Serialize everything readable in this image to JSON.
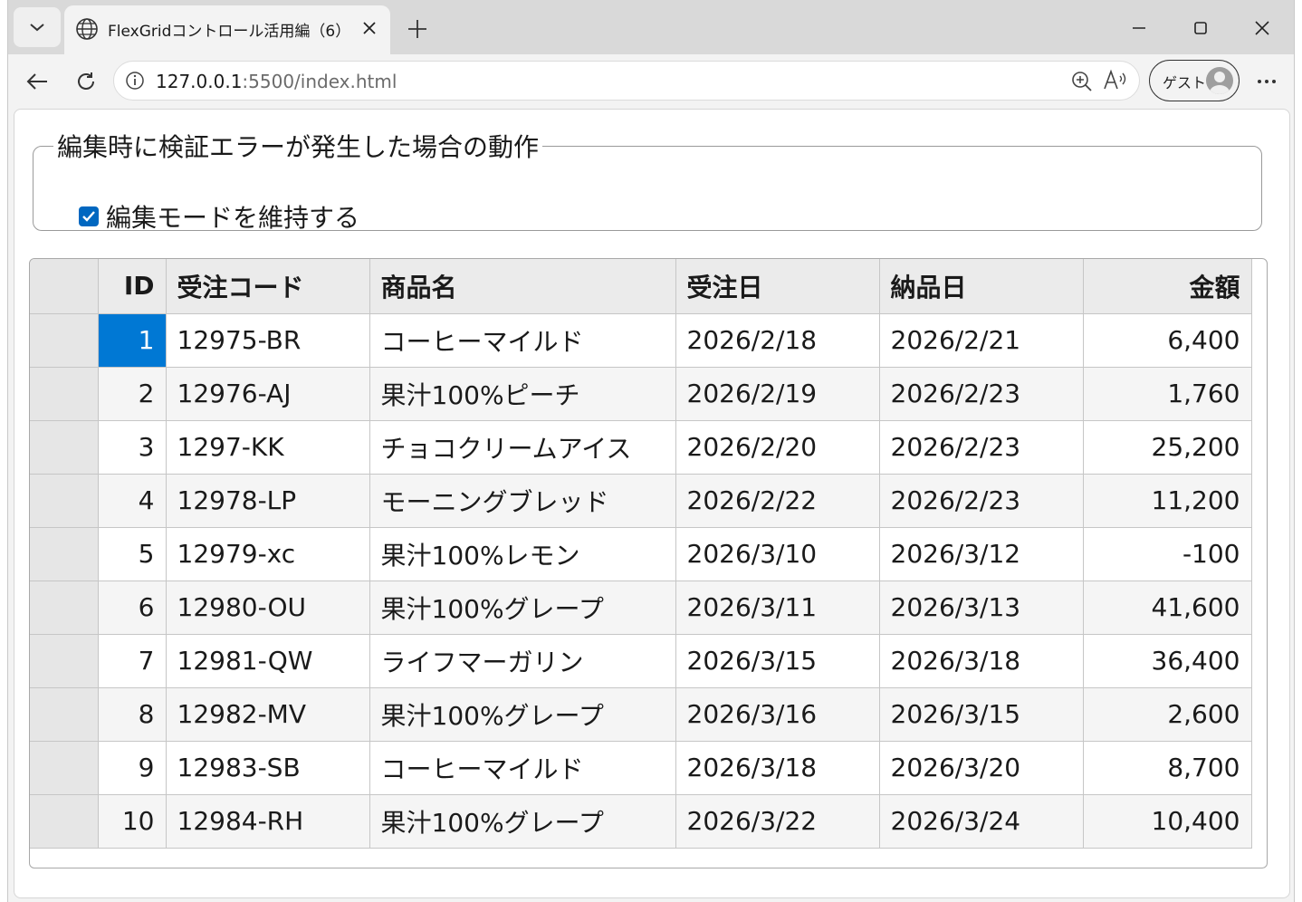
{
  "browser": {
    "tab_title": "FlexGridコントロール活用編（6）",
    "url_host": "127.0.0.1",
    "url_rest": ":5500/index.html",
    "guest_label": "ゲスト"
  },
  "page": {
    "fieldset_legend": "編集時に検証エラーが発生した場合の動作",
    "checkbox_label": "編集モードを維持する",
    "checkbox_checked": true
  },
  "grid": {
    "columns": [
      {
        "label": "ID",
        "align": "right"
      },
      {
        "label": "受注コード",
        "align": "left"
      },
      {
        "label": "商品名",
        "align": "left"
      },
      {
        "label": "受注日",
        "align": "left"
      },
      {
        "label": "納品日",
        "align": "left"
      },
      {
        "label": "金額",
        "align": "right"
      }
    ],
    "rows": [
      [
        "1",
        "12975-BR",
        "コーヒーマイルド",
        "2026/2/18",
        "2026/2/21",
        "6,400"
      ],
      [
        "2",
        "12976-AJ",
        "果汁100%ピーチ",
        "2026/2/19",
        "2026/2/23",
        "1,760"
      ],
      [
        "3",
        "1297-KK",
        "チョコクリームアイス",
        "2026/2/20",
        "2026/2/23",
        "25,200"
      ],
      [
        "4",
        "12978-LP",
        "モーニングブレッド",
        "2026/2/22",
        "2026/2/23",
        "11,200"
      ],
      [
        "5",
        "12979-xc",
        "果汁100%レモン",
        "2026/3/10",
        "2026/3/12",
        "-100"
      ],
      [
        "6",
        "12980-OU",
        "果汁100%グレープ",
        "2026/3/11",
        "2026/3/13",
        "41,600"
      ],
      [
        "7",
        "12981-QW",
        "ライフマーガリン",
        "2026/3/15",
        "2026/3/18",
        "36,400"
      ],
      [
        "8",
        "12982-MV",
        "果汁100%グレープ",
        "2026/3/16",
        "2026/3/15",
        "2,600"
      ],
      [
        "9",
        "12983-SB",
        "コーヒーマイルド",
        "2026/3/18",
        "2026/3/20",
        "8,700"
      ],
      [
        "10",
        "12984-RH",
        "果汁100%グレープ",
        "2026/3/22",
        "2026/3/24",
        "10,400"
      ]
    ],
    "selected": {
      "row": 0,
      "col": 0
    },
    "selection_color": "#0078d4"
  }
}
